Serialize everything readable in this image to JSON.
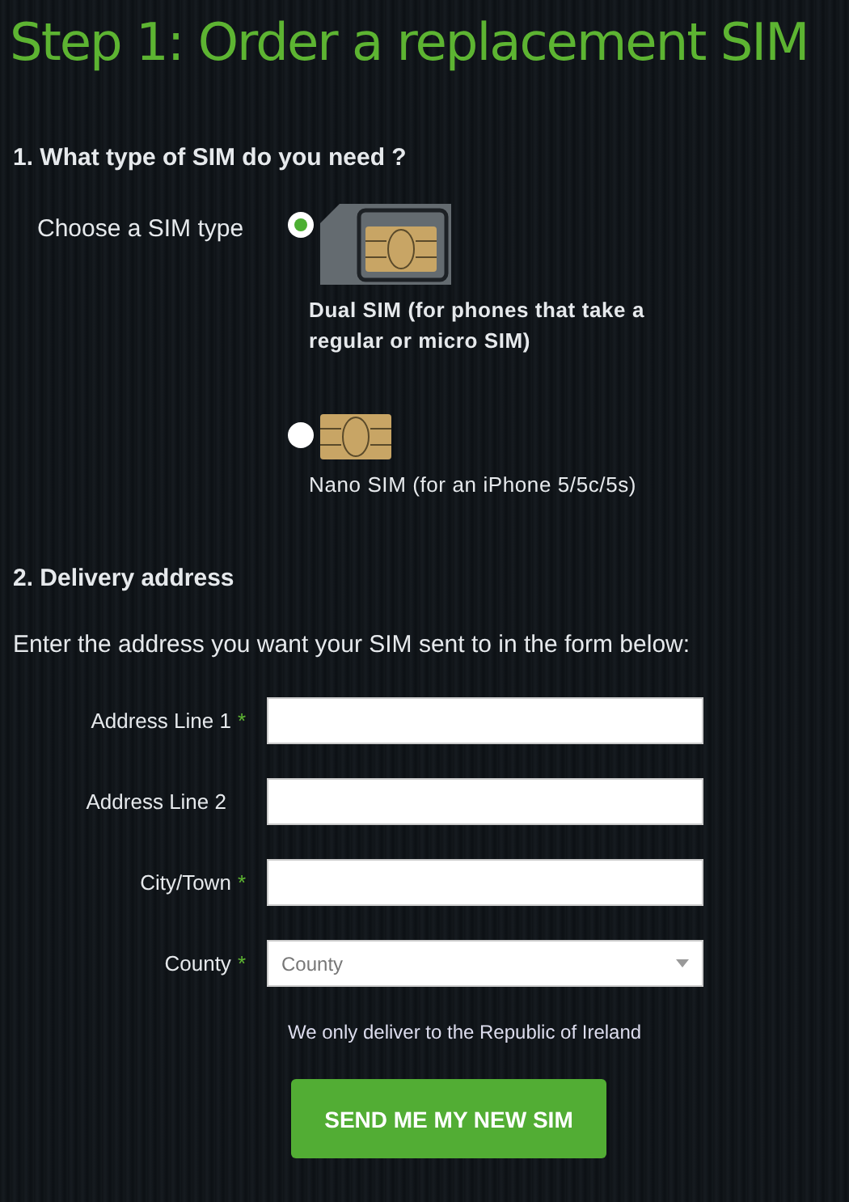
{
  "title": "Step 1: Order a replacement SIM",
  "sim_section": {
    "heading": "1. What type of SIM do you need ?",
    "label": "Choose a SIM type",
    "options": [
      {
        "kind": "dual",
        "selected": true,
        "label": "Dual SIM (for phones that take a regular or micro SIM)"
      },
      {
        "kind": "nano",
        "selected": false,
        "label": "Nano SIM (for an iPhone 5/5c/5s)"
      }
    ]
  },
  "address_section": {
    "heading": "2. Delivery address",
    "intro": "Enter the address you want your SIM sent to in the form below:",
    "fields": [
      {
        "kind": "text",
        "label": "Address Line 1",
        "required": true
      },
      {
        "kind": "text",
        "label": "Address Line 2",
        "required": false
      },
      {
        "kind": "text",
        "label": "City/Town",
        "required": true
      },
      {
        "kind": "select",
        "label": "County",
        "required": true,
        "placeholder": "County"
      }
    ],
    "required_mark": "*",
    "note": "We only deliver to the Republic of Ireland",
    "submit": "SEND ME MY NEW SIM"
  }
}
